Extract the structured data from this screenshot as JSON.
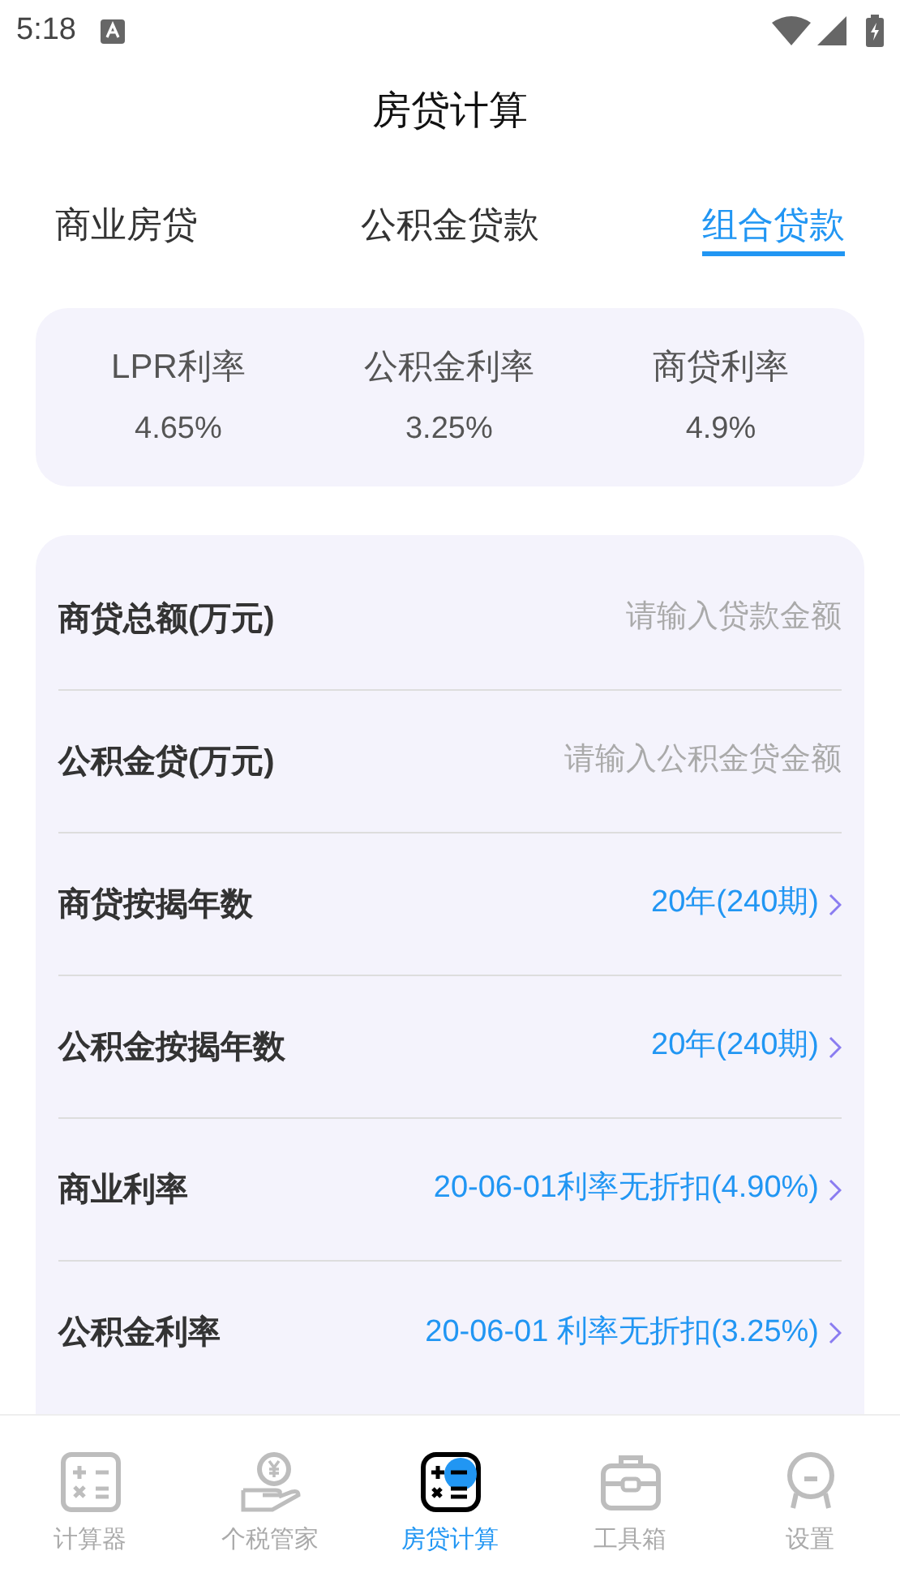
{
  "status_bar": {
    "time": "5:18"
  },
  "title": "房贷计算",
  "tabs": [
    {
      "label": "商业房贷",
      "selected": false
    },
    {
      "label": "公积金贷款",
      "selected": false
    },
    {
      "label": "组合贷款",
      "selected": true
    }
  ],
  "rates": [
    {
      "label": "LPR利率",
      "value": "4.65%"
    },
    {
      "label": "公积金利率",
      "value": "3.25%"
    },
    {
      "label": "商贷利率",
      "value": "4.9%"
    }
  ],
  "form": [
    {
      "kind": "input",
      "label": "商贷总额(万元)",
      "placeholder": "请输入贷款金额"
    },
    {
      "kind": "input",
      "label": "公积金贷(万元)",
      "placeholder": "请输入公积金贷金额"
    },
    {
      "kind": "select",
      "label": "商贷按揭年数",
      "value": "20年(240期)"
    },
    {
      "kind": "select",
      "label": "公积金按揭年数",
      "value": "20年(240期)"
    },
    {
      "kind": "select",
      "label": "商业利率",
      "value": "20-06-01利率无折扣(4.90%)"
    },
    {
      "kind": "select",
      "label": "公积金利率",
      "value": "20-06-01 利率无折扣(3.25%)"
    }
  ],
  "bottom_nav": [
    {
      "kind": "calculator",
      "label": "计算器",
      "selected": false
    },
    {
      "kind": "tax",
      "label": "个税管家",
      "selected": false
    },
    {
      "kind": "loan",
      "label": "房贷计算",
      "selected": true
    },
    {
      "kind": "toolbox",
      "label": "工具箱",
      "selected": false
    },
    {
      "kind": "settings",
      "label": "设置",
      "selected": false
    }
  ]
}
